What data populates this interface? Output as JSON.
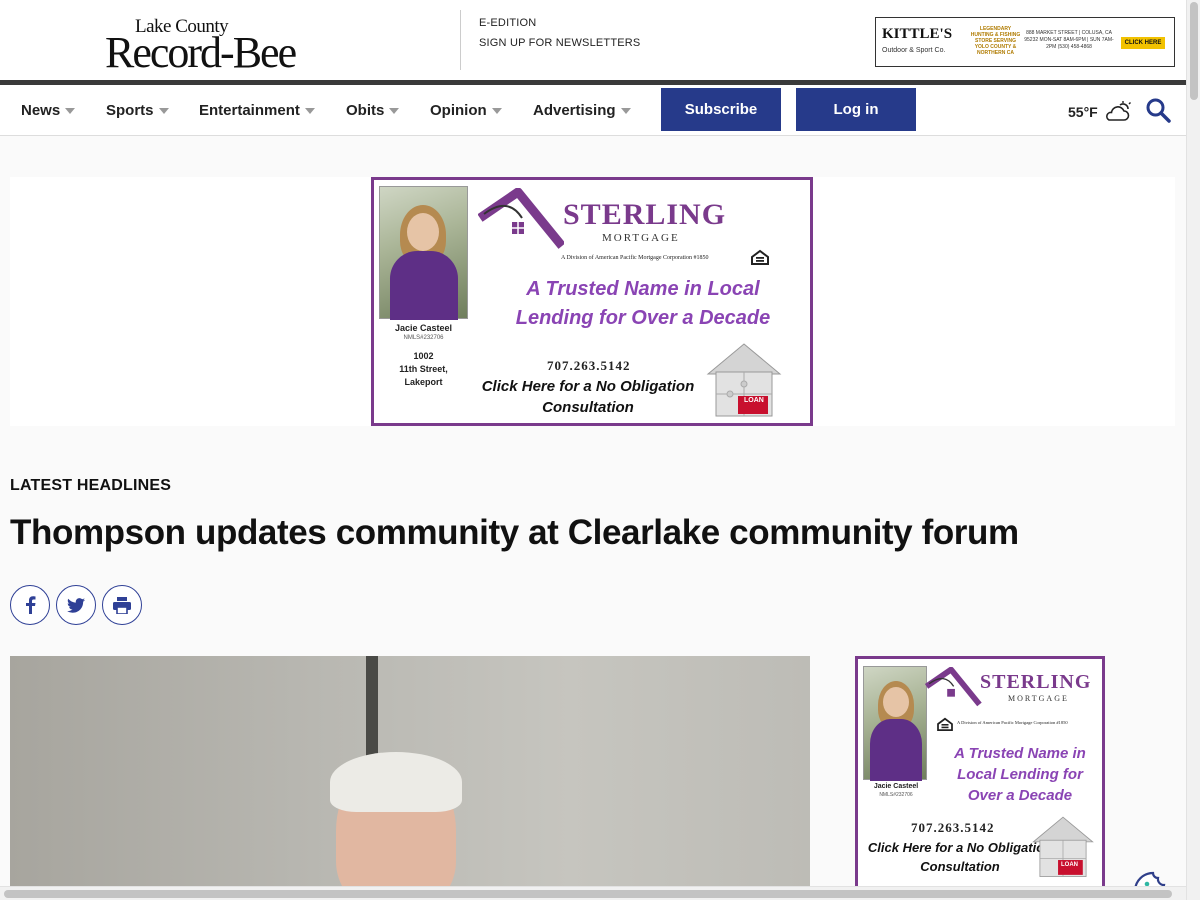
{
  "masthead": {
    "logo_top": "Lake County",
    "logo_main": "Record-Bee",
    "links": [
      "E-EDITION",
      "SIGN UP FOR NEWSLETTERS"
    ]
  },
  "top_ad": {
    "brand": "KITTLE'S",
    "brand_sub": "Outdoor & Sport Co.",
    "middle": "LEGENDARY HUNTING & FISHING STORE SERVING YOLO COUNTY & NORTHERN CA",
    "address": "888 MARKET STREET | COLUSA, CA 95232 MON-SAT 8AM-6PM | SUN 7AM-2PM (530) 458-4868",
    "cta": "CLICK HERE"
  },
  "nav": {
    "items": [
      {
        "label": "News"
      },
      {
        "label": "Sports"
      },
      {
        "label": "Entertainment"
      },
      {
        "label": "Obits"
      },
      {
        "label": "Opinion"
      },
      {
        "label": "Advertising"
      }
    ],
    "subscribe_label": "Subscribe",
    "login_label": "Log in",
    "weather_temp": "55°F",
    "weather_icon": "partly-cloudy-icon"
  },
  "big_ad": {
    "agent_name": "Jacie Casteel",
    "agent_nmls": "NMLS#232706",
    "agent_address": "1002\n11th Street,\nLakeport",
    "brand": "STERLING",
    "brand_sub": "MORTGAGE",
    "division": "A Division of American Pacific Mortgage Corporation #1850",
    "tagline": "A Trusted Name in Local Lending for Over a Decade",
    "phone": "707.263.5142",
    "cta": "Click Here for a No Obligation Consultation",
    "badge": "LOAN"
  },
  "article": {
    "section_label": "LATEST HEADLINES",
    "headline": "Thompson updates community at Clearlake community forum",
    "share": [
      "facebook-icon",
      "twitter-icon",
      "print-icon"
    ]
  },
  "side_ad": {
    "agent_name": "Jacie Casteel",
    "agent_nmls": "NMLS#232706",
    "brand": "STERLING",
    "brand_sub": "MORTGAGE",
    "division": "A Division of American Pacific Mortgage Corporation #1850",
    "tagline": "A Trusted Name in Local Lending for Over a Decade",
    "phone": "707.263.5142",
    "cta": "Click Here for a No Obligation Consultation",
    "badge": "LOAN"
  },
  "colors": {
    "brand_navy": "#263a8a",
    "ad_purple": "#7a3a8c",
    "tagline_purple": "#8a44b4"
  }
}
